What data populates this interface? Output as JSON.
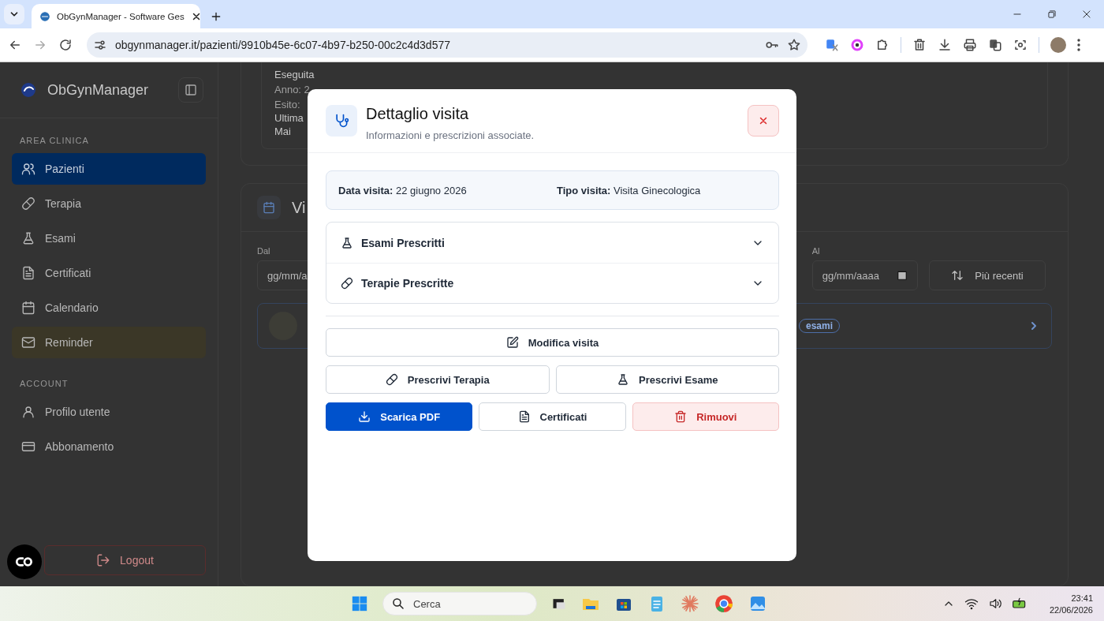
{
  "browser": {
    "tab_title": "ObGynManager - Software Ges",
    "url": "obgynmanager.it/pazienti/9910b45e-6c07-4b97-b250-00c2c4d3d577"
  },
  "sidebar": {
    "brand": "ObGynManager",
    "sections": [
      {
        "heading": "AREA CLINICA",
        "items": [
          {
            "label": "Pazienti",
            "selected": true,
            "highlighted": false
          },
          {
            "label": "Terapia",
            "selected": false,
            "highlighted": false
          },
          {
            "label": "Esami",
            "selected": false,
            "highlighted": false
          },
          {
            "label": "Certificati",
            "selected": false,
            "highlighted": false
          },
          {
            "label": "Calendario",
            "selected": false,
            "highlighted": false
          },
          {
            "label": "Reminder",
            "selected": false,
            "highlighted": true
          }
        ]
      },
      {
        "heading": "ACCOUNT",
        "items": [
          {
            "label": "Profilo utente",
            "selected": false,
            "highlighted": false
          },
          {
            "label": "Abbonamento",
            "selected": false,
            "highlighted": false
          }
        ]
      }
    ],
    "logout": "Logout"
  },
  "background": {
    "note_lines": [
      {
        "text": "Eseguita",
        "kind": "value"
      },
      {
        "text": "Anno: 2",
        "kind": "meta"
      },
      {
        "text": "Esito:",
        "kind": "meta"
      },
      {
        "text": "Ultima",
        "kind": "value"
      },
      {
        "text": "Mai",
        "kind": "value"
      }
    ],
    "visits_title": "Vi",
    "from_label": "Dal",
    "from_placeholder": "gg/mm/a",
    "to_label": "Al",
    "to_placeholder": "gg/mm/aaaa",
    "sort_button": "Più recenti",
    "badge": "esami"
  },
  "modal": {
    "title": "Dettaglio visita",
    "subtitle": "Informazioni e prescrizioni associate.",
    "info": [
      "**Data visita:** 22 giugno 2026",
      "**Tipo visita:** Visita Ginecologica"
    ],
    "sections": [
      {
        "title": "Esami Prescritti",
        "expanded": false
      },
      {
        "title": "Terapie Prescritte",
        "expanded": false
      }
    ],
    "action_rows": [
      {
        "buttons": [
          {
            "label": "Modifica visita",
            "kind": "outline"
          }
        ]
      },
      {
        "buttons": [
          {
            "label": "Prescrivi Terapia",
            "kind": "outline"
          },
          {
            "label": "Prescrivi Esame",
            "kind": "outline"
          }
        ]
      },
      {
        "buttons": [
          {
            "label": "Scarica PDF",
            "kind": "primary"
          },
          {
            "label": "Certificati",
            "kind": "outline"
          },
          {
            "label": "Rimuovi",
            "kind": "danger"
          }
        ]
      }
    ]
  },
  "taskbar": {
    "search": "Cerca",
    "time": "23:41",
    "date": "22/06/2026"
  }
}
